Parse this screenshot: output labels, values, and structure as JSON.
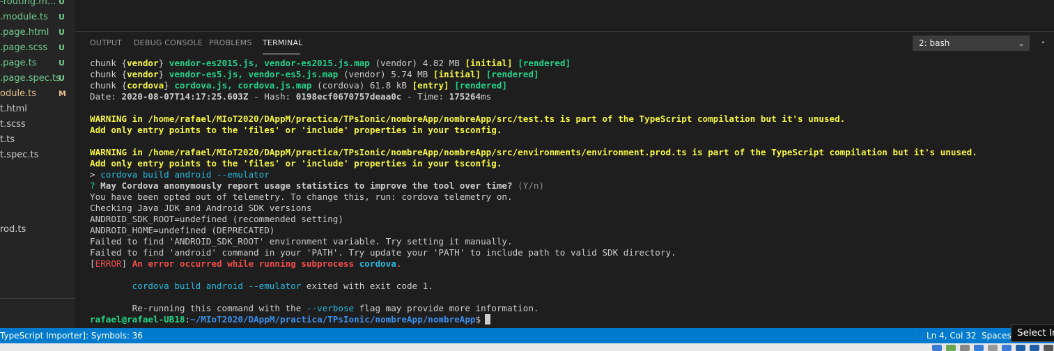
{
  "sidebar": {
    "items": [
      {
        "name": "-routing.m...",
        "badge": "U",
        "color": "#73c991"
      },
      {
        "name": ".module.ts",
        "badge": "U",
        "color": "#73c991"
      },
      {
        "name": ".page.html",
        "badge": "U",
        "color": "#73c991"
      },
      {
        "name": ".page.scss",
        "badge": "U",
        "color": "#73c991"
      },
      {
        "name": ".page.ts",
        "badge": "U",
        "color": "#73c991"
      },
      {
        "name": ".page.spec.ts",
        "badge": "U",
        "color": "#73c991"
      },
      {
        "name": "odule.ts",
        "badge": "M",
        "color": "#e2c08d"
      },
      {
        "name": "t.html",
        "badge": "",
        "color": "#cccccc"
      },
      {
        "name": "t.scss",
        "badge": "",
        "color": "#cccccc"
      },
      {
        "name": "t.ts",
        "badge": "",
        "color": "#cccccc"
      },
      {
        "name": "t.spec.ts",
        "badge": "",
        "color": "#cccccc"
      },
      {
        "name": "rod.ts",
        "badge": "",
        "color": "#cccccc"
      }
    ]
  },
  "panel": {
    "tabs": [
      {
        "label": "OUTPUT"
      },
      {
        "label": "DEBUG CONSOLE"
      },
      {
        "label": "PROBLEMS"
      },
      {
        "label": "TERMINAL"
      }
    ],
    "terminal_select": "2: bash",
    "add_icon": "plus-icon"
  },
  "terminal": {
    "lines": [
      {
        "segs": [
          {
            "t": "chunk {"
          },
          {
            "t": "vendor",
            "c": "yellow b"
          },
          {
            "t": "} "
          },
          {
            "t": "vendor-es2015.js, vendor-es2015.js.map",
            "c": "green b"
          },
          {
            "t": " (vendor) 4.82 MB "
          },
          {
            "t": "[initial]",
            "c": "yellow b"
          },
          {
            "t": " "
          },
          {
            "t": "[rendered]",
            "c": "green b"
          }
        ]
      },
      {
        "segs": [
          {
            "t": "chunk {"
          },
          {
            "t": "vendor",
            "c": "yellow b"
          },
          {
            "t": "} "
          },
          {
            "t": "vendor-es5.js, vendor-es5.js.map",
            "c": "green b"
          },
          {
            "t": " (vendor) 5.74 MB "
          },
          {
            "t": "[initial]",
            "c": "yellow b"
          },
          {
            "t": " "
          },
          {
            "t": "[rendered]",
            "c": "green b"
          }
        ]
      },
      {
        "segs": [
          {
            "t": "chunk {"
          },
          {
            "t": "cordova",
            "c": "yellow b"
          },
          {
            "t": "} "
          },
          {
            "t": "cordova.js, cordova.js.map",
            "c": "green b"
          },
          {
            "t": " (cordova) 61.8 kB "
          },
          {
            "t": "[entry]",
            "c": "yellow b"
          },
          {
            "t": " "
          },
          {
            "t": "[rendered]",
            "c": "green b"
          }
        ]
      },
      {
        "segs": [
          {
            "t": "Date: "
          },
          {
            "t": "2020-08-07T14:17:25.603Z",
            "c": "b"
          },
          {
            "t": " - Hash: "
          },
          {
            "t": "0198ecf0670757deaa0c",
            "c": "b"
          },
          {
            "t": " - Time: "
          },
          {
            "t": "175264",
            "c": "b"
          },
          {
            "t": "ms"
          }
        ]
      },
      {
        "segs": []
      },
      {
        "segs": [
          {
            "t": "WARNING in /home/rafael/MIoT2020/DAppM/practica/TPsIonic/nombreApp/nombreApp/src/test.ts is part of the TypeScript compilation but it's unused.",
            "c": "yellow b"
          }
        ]
      },
      {
        "segs": [
          {
            "t": "Add only entry points to the 'files' or 'include' properties in your tsconfig.",
            "c": "yellow b"
          }
        ]
      },
      {
        "segs": []
      },
      {
        "segs": [
          {
            "t": "WARNING in /home/rafael/MIoT2020/DAppM/practica/TPsIonic/nombreApp/nombreApp/src/environments/environment.prod.ts is part of the TypeScript compilation but it's unused.",
            "c": "yellow b"
          }
        ]
      },
      {
        "segs": [
          {
            "t": "Add only entry points to the 'files' or 'include' properties in your tsconfig.",
            "c": "yellow b"
          }
        ]
      },
      {
        "segs": [
          {
            "t": "> "
          },
          {
            "t": "cordova build android --emulator",
            "c": "cyan"
          }
        ]
      },
      {
        "segs": [
          {
            "t": "? ",
            "c": "green"
          },
          {
            "t": "May Cordova anonymously report usage statistics to improve the tool over time?",
            "c": "b"
          },
          {
            "t": " (Y/n)",
            "c": "gray"
          }
        ]
      },
      {
        "segs": [
          {
            "t": "You have been opted out of telemetry. To change this, run: cordova telemetry on."
          }
        ]
      },
      {
        "segs": [
          {
            "t": "Checking Java JDK and Android SDK versions"
          }
        ]
      },
      {
        "segs": [
          {
            "t": "ANDROID_SDK_ROOT=undefined (recommended setting)"
          }
        ]
      },
      {
        "segs": [
          {
            "t": "ANDROID_HOME=undefined (DEPRECATED)"
          }
        ]
      },
      {
        "segs": [
          {
            "t": "Failed to find 'ANDROID_SDK_ROOT' environment variable. Try setting it manually."
          }
        ]
      },
      {
        "segs": [
          {
            "t": "Failed to find 'android' command in your 'PATH'. Try update your 'PATH' to include path to valid SDK directory."
          }
        ]
      },
      {
        "segs": [
          {
            "t": "["
          },
          {
            "t": "ERROR",
            "c": "red"
          },
          {
            "t": "] "
          },
          {
            "t": "An error occurred while running subprocess ",
            "c": "red b"
          },
          {
            "t": "cordova",
            "c": "cyan b"
          },
          {
            "t": ".",
            "c": "red b"
          }
        ]
      },
      {
        "segs": []
      },
      {
        "segs": [
          {
            "t": "        "
          },
          {
            "t": "cordova build android --emulator",
            "c": "cyan"
          },
          {
            "t": " exited with exit code 1."
          }
        ]
      },
      {
        "segs": []
      },
      {
        "segs": [
          {
            "t": "        Re-running this command with the "
          },
          {
            "t": "--verbose",
            "c": "cyan"
          },
          {
            "t": " flag may provide more information."
          }
        ]
      }
    ],
    "prompt_user": "rafael@rafael-UB18",
    "prompt_sep": ":",
    "prompt_path": "~/MIoT2020/DAppM/practica/TPsIonic/nombreApp/nombreApp",
    "prompt_end": "$"
  },
  "statusbar": {
    "left": "TypeScript Importer]: Symbols: 36",
    "position": "Ln 4, Col 32",
    "spaces": "Spaces:"
  },
  "tooltip": "Select Ir",
  "colors": {
    "accent": "#007acc",
    "git_untracked": "#73c991",
    "git_modified": "#e2c08d"
  }
}
